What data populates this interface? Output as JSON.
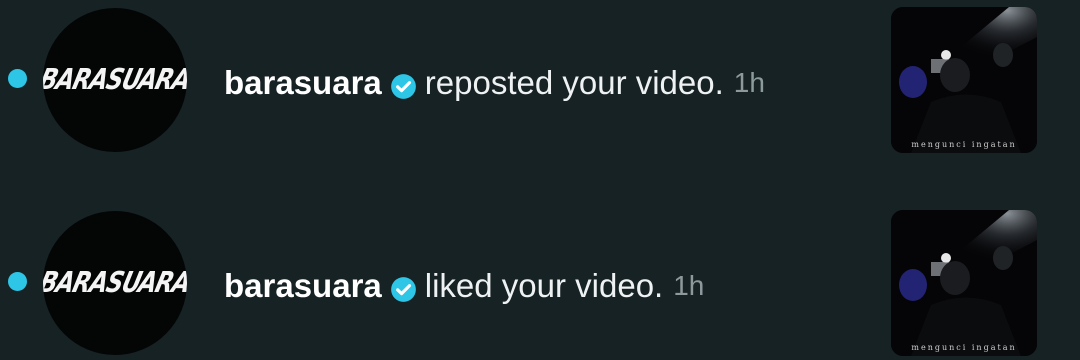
{
  "notifications": [
    {
      "avatar_text": "BARASUARA",
      "username": "barasuara",
      "verified_icon": "verified-check-icon",
      "action": "reposted your video.",
      "time": "1h",
      "thumbnail_caption": "mengunci ingatan"
    },
    {
      "avatar_text": "BARASUARA",
      "username": "barasuara",
      "verified_icon": "verified-check-icon",
      "action": "liked your video.",
      "time": "1h",
      "thumbnail_caption": "mengunci ingatan"
    }
  ],
  "colors": {
    "background": "#172225",
    "unread_dot": "#2ec6e6",
    "verified_badge": "#2ec6e6",
    "timestamp": "#8d9a9c"
  }
}
